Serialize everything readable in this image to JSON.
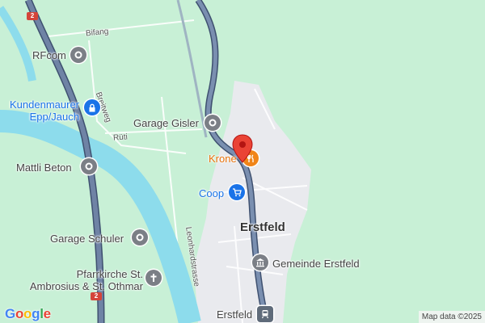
{
  "map": {
    "background": "#c8f0d6",
    "river_color": "#8ddcec",
    "highway_color": "#5a6f8f",
    "town_color": "#e9eaee"
  },
  "labels": {
    "bifang": "Bifang",
    "breitweg": "Breitweg",
    "ruti": "Rüti",
    "leonhardstrasse": "Leonhardstrasse"
  },
  "places": {
    "rfcom": "RFcom",
    "kundenmaurer_line1": "Kundenmaurer",
    "kundenmaurer_line2": "Epp/Jauch",
    "garage_gisler": "Garage Gisler",
    "mattli_beton": "Mattli Beton",
    "krone": "Krone",
    "coop": "Coop",
    "erstfeld": "Erstfeld",
    "garage_schuler": "Garage Schuler",
    "gemeinde": "Gemeinde Erstfeld",
    "church_line1": "Pfarrkirche St.",
    "church_line2": "Ambrosius & St. Othmar",
    "erstfeld_station": "Erstfeld"
  },
  "shields": {
    "top": "2",
    "bottom": "2"
  },
  "icons": {
    "rfcom": "circle-icon",
    "kundenmaurer": "lock-icon",
    "garage_gisler": "circle-icon",
    "mattli_beton": "circle-icon",
    "krone": "fork-knife-icon",
    "coop": "shopping-cart-icon",
    "garage_schuler": "circle-icon",
    "gemeinde": "government-building-icon",
    "church": "cross-icon",
    "station": "train-icon",
    "marker": "location-pin-icon"
  },
  "branding": {
    "logo_letters": [
      "G",
      "o",
      "o",
      "g",
      "l",
      "e"
    ],
    "attribution": "Map data ©2025"
  }
}
